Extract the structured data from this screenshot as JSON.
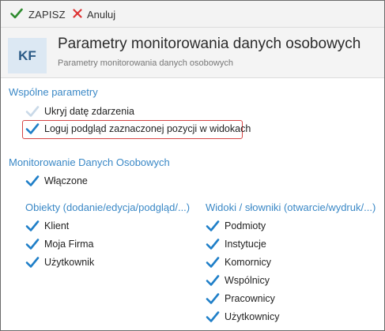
{
  "toolbar": {
    "save_label": "ZAPISZ",
    "cancel_label": "Anuluj"
  },
  "header": {
    "logo": "KF",
    "title": "Parametry monitorowania danych osobowych",
    "subtitle": "Parametry monitorowania danych osobowych"
  },
  "common": {
    "title": "Wspólne parametry",
    "hide_date": {
      "label": "Ukryj datę zdarzenia",
      "checked": false
    },
    "log_preview": {
      "label": "Loguj podgląd zaznaczonej pozycji w widokach",
      "checked": true
    }
  },
  "monitoring": {
    "title": "Monitorowanie Danych Osobowych",
    "enabled": {
      "label": "Włączone",
      "checked": true
    }
  },
  "objects": {
    "title": "Obiekty (dodanie/edycja/podgląd/...)",
    "items": [
      {
        "label": "Klient",
        "checked": true
      },
      {
        "label": "Moja Firma",
        "checked": true
      },
      {
        "label": "Użytkownik",
        "checked": true
      }
    ]
  },
  "views": {
    "title": "Widoki / słowniki (otwarcie/wydruk/...)",
    "items": [
      {
        "label": "Podmioty",
        "checked": true
      },
      {
        "label": "Instytucje",
        "checked": true
      },
      {
        "label": "Komornicy",
        "checked": true
      },
      {
        "label": "Wspólnicy",
        "checked": true
      },
      {
        "label": "Pracownicy",
        "checked": true
      },
      {
        "label": "Użytkownicy",
        "checked": true
      }
    ]
  },
  "colors": {
    "accent": "#3a88c6",
    "check": "#1f7fc8",
    "check_disabled": "#c9d9e8",
    "highlight_border": "#d64545"
  },
  "icons": {
    "save": "checkmark-icon",
    "cancel": "close-icon",
    "checkbox": "checkmark-icon"
  }
}
